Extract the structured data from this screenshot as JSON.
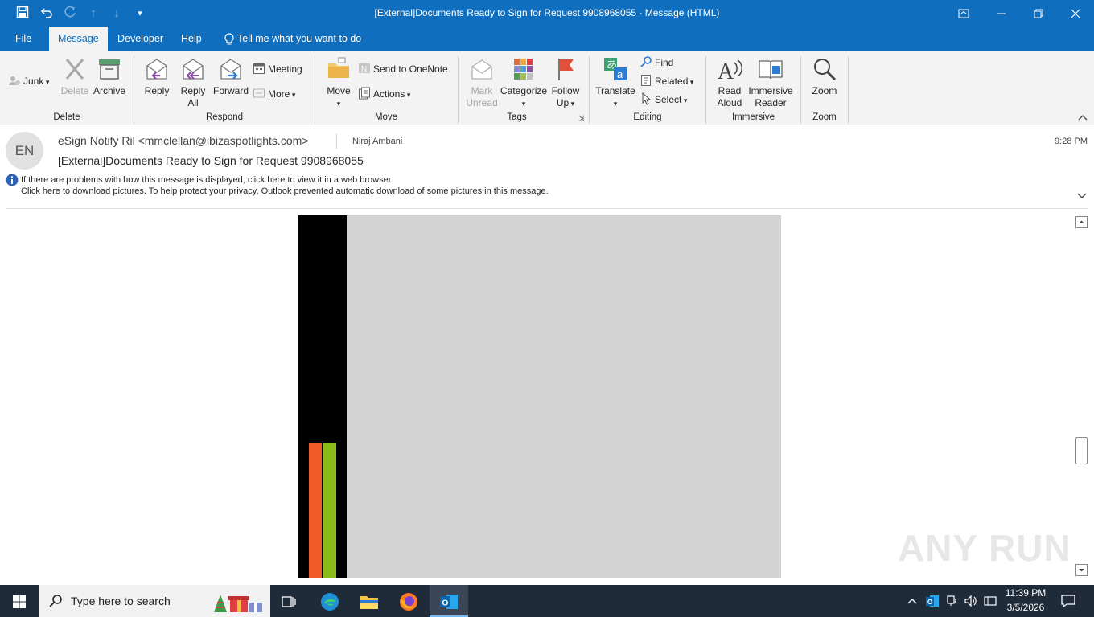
{
  "window": {
    "title": "[External]Documents Ready to Sign for Request 9908968055  -  Message (HTML)"
  },
  "tabs": [
    {
      "label": "File"
    },
    {
      "label": "Message"
    },
    {
      "label": "Developer"
    },
    {
      "label": "Help"
    },
    {
      "label": "Tell me what you want to do"
    }
  ],
  "ribbon": {
    "delete": {
      "junk": "Junk",
      "delete": "Delete",
      "archive": "Archive",
      "group": "Delete"
    },
    "respond": {
      "reply": "Reply",
      "reply_all_1": "Reply",
      "reply_all_2": "All",
      "forward": "Forward",
      "meeting": "Meeting",
      "more": "More",
      "group": "Respond"
    },
    "move": {
      "move": "Move",
      "onenote": "Send to OneNote",
      "actions": "Actions",
      "group": "Move"
    },
    "tags": {
      "mark_1": "Mark",
      "mark_2": "Unread",
      "categorize": "Categorize",
      "follow_1": "Follow",
      "follow_2": "Up",
      "group": "Tags"
    },
    "editing": {
      "translate": "Translate",
      "find": "Find",
      "related": "Related",
      "select": "Select",
      "group": "Editing"
    },
    "immersive": {
      "read_1": "Read",
      "read_2": "Aloud",
      "reader_1": "Immersive",
      "reader_2": "Reader",
      "group": "Immersive"
    },
    "zoom": {
      "zoom": "Zoom",
      "group": "Zoom"
    }
  },
  "message": {
    "avatar_initials": "EN",
    "from": "eSign Notify Ril <mmclellan@ibizaspotlights.com>",
    "to": "Niraj Ambani",
    "time": "9:28 PM",
    "subject": "[External]Documents Ready to Sign for Request 9908968055",
    "info_1": "If there are problems with how this message is displayed, click here to view it in a web browser.",
    "info_2": "Click here to download pictures. To help protect your privacy, Outlook prevented automatic download of some pictures in this message."
  },
  "taskbar": {
    "search_placeholder": "Type here to search",
    "time": "11:39 PM",
    "date": "3/5/2026"
  },
  "watermark": "ANY RUN",
  "colors": {
    "accent": "#106ebe",
    "orange_bar": "#f05a28",
    "green_bar": "#8bbb1a",
    "image_placeholder": "#d3d3d3"
  }
}
